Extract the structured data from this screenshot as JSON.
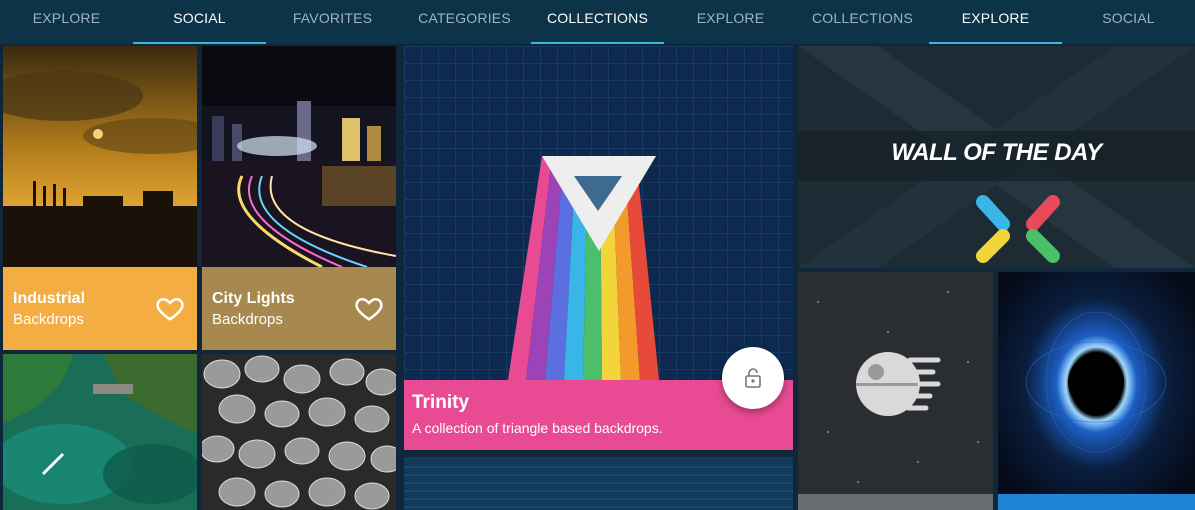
{
  "tabs": [
    {
      "label": "EXPLORE",
      "active": false
    },
    {
      "label": "SOCIAL",
      "active": true
    },
    {
      "label": "FAVORITES",
      "active": false
    },
    {
      "label": "CATEGORIES",
      "active": false
    },
    {
      "label": "COLLECTIONS",
      "active": true
    },
    {
      "label": "EXPLORE",
      "active": false
    },
    {
      "label": "COLLECTIONS",
      "active": false
    },
    {
      "label": "EXPLORE",
      "active": true
    },
    {
      "label": "SOCIAL",
      "active": false
    }
  ],
  "cards": {
    "industrial": {
      "title": "Industrial",
      "subtitle": "Backdrops",
      "color": "#f3ad42"
    },
    "city": {
      "title": "City Lights",
      "subtitle": "Backdrops",
      "color": "#a7884e"
    }
  },
  "trinity": {
    "title": "Trinity",
    "subtitle": "A collection of triangle based backdrops.",
    "color": "#e84b93"
  },
  "wall_of_day": {
    "label": "WALL OF THE DAY"
  },
  "colors": {
    "accent": "#3bb6d9",
    "tabbar": "#0d3349"
  }
}
